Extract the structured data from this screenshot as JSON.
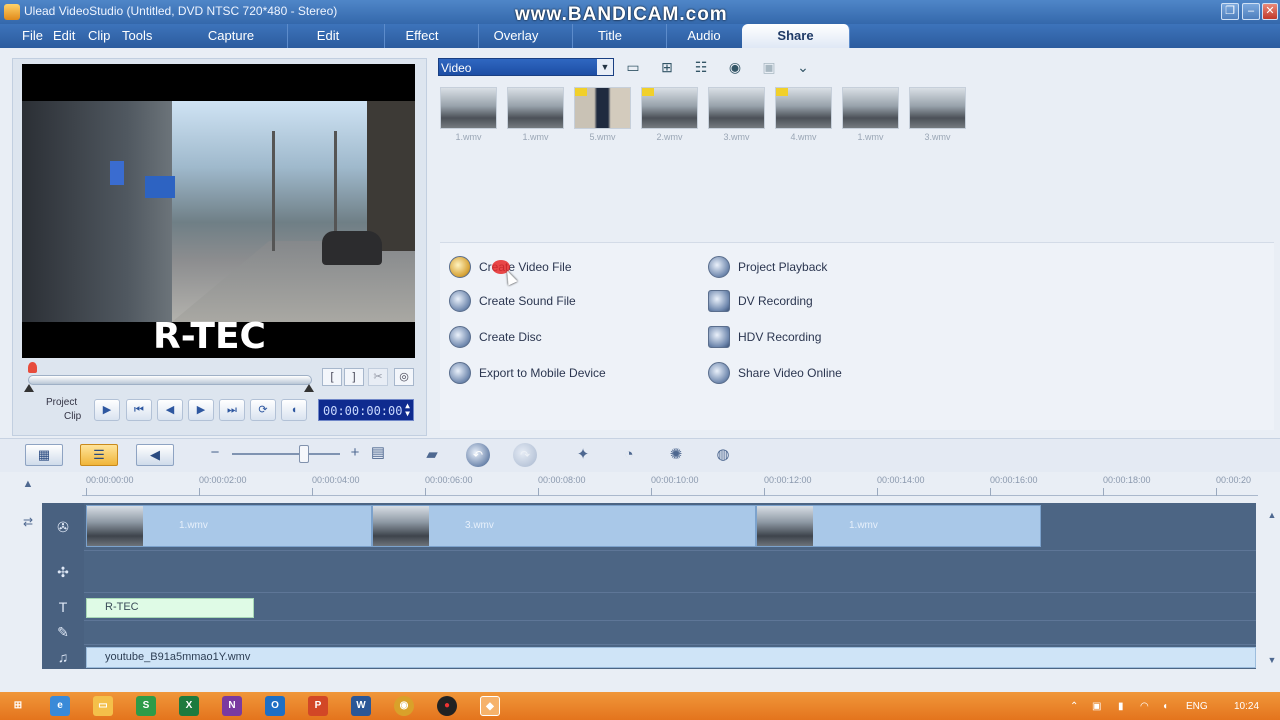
{
  "window": {
    "title": "Ulead VideoStudio (Untitled, DVD NTSC 720*480 - Stereo)",
    "watermark": "www.BANDICAM.com"
  },
  "menu": {
    "items": [
      "File",
      "Edit",
      "Clip",
      "Tools"
    ],
    "steps": [
      "Capture",
      "Edit",
      "Effect",
      "Overlay",
      "Title",
      "Audio",
      "Share"
    ],
    "active_step": "Share"
  },
  "preview": {
    "overlay_text": "R-TEC",
    "mode_project": "Project",
    "mode_clip": "Clip",
    "timecode": "00:00:00:00",
    "mark_in": "[",
    "mark_out": "]"
  },
  "library": {
    "category": "Video",
    "thumbnails": [
      {
        "label": "1.wmv",
        "marked": false,
        "person": false
      },
      {
        "label": "1.wmv",
        "marked": false,
        "person": false
      },
      {
        "label": "5.wmv",
        "marked": true,
        "person": true
      },
      {
        "label": "2.wmv",
        "marked": true,
        "person": false
      },
      {
        "label": "3.wmv",
        "marked": false,
        "person": false
      },
      {
        "label": "4.wmv",
        "marked": true,
        "person": false
      },
      {
        "label": "1.wmv",
        "marked": false,
        "person": false
      },
      {
        "label": "3.wmv",
        "marked": false,
        "person": false
      }
    ]
  },
  "share": {
    "left": [
      {
        "label": "Create Video File",
        "icon": "film-reel-icon"
      },
      {
        "label": "Create Sound File",
        "icon": "sound-file-icon"
      },
      {
        "label": "Create Disc",
        "icon": "disc-icon"
      },
      {
        "label": "Export to Mobile Device",
        "icon": "mobile-device-icon"
      }
    ],
    "right": [
      {
        "label": "Project Playback",
        "icon": "playback-icon"
      },
      {
        "label": "DV Recording",
        "icon": "dv-camera-icon"
      },
      {
        "label": "HDV Recording",
        "icon": "hdv-camera-icon"
      },
      {
        "label": "Share Video Online",
        "icon": "share-online-icon"
      }
    ]
  },
  "timeline": {
    "ruler": [
      "00:00:00:00",
      "00:00:02:00",
      "00:00:04:00",
      "00:00:06:00",
      "00:00:08:00",
      "00:00:10:00",
      "00:00:12:00",
      "00:00:14:00",
      "00:00:16:00",
      "00:00:18:00",
      "00:00:20"
    ],
    "video_clips": [
      "1.wmv",
      "3.wmv",
      "1.wmv"
    ],
    "title_clip": "R-TEC",
    "music_clip": "youtube_B91a5mmao1Y.wmv"
  },
  "taskbar": {
    "lang": "ENG",
    "time": "10:24"
  }
}
